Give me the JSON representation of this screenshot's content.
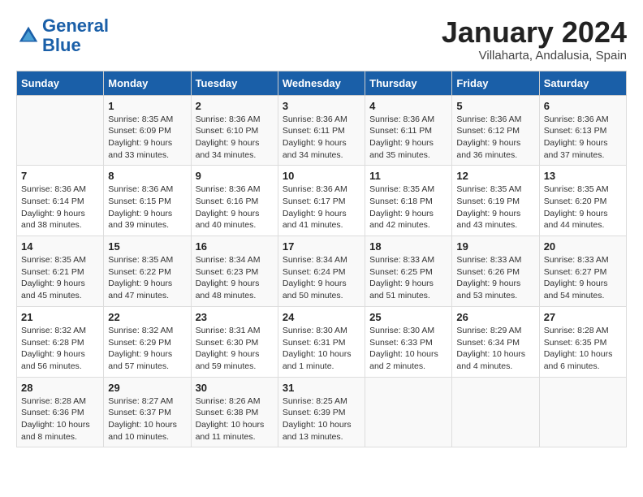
{
  "header": {
    "logo_line1": "General",
    "logo_line2": "Blue",
    "main_title": "January 2024",
    "subtitle": "Villaharta, Andalusia, Spain"
  },
  "calendar": {
    "weekdays": [
      "Sunday",
      "Monday",
      "Tuesday",
      "Wednesday",
      "Thursday",
      "Friday",
      "Saturday"
    ],
    "weeks": [
      [
        {
          "day": "",
          "sunrise": "",
          "sunset": "",
          "daylight": ""
        },
        {
          "day": "1",
          "sunrise": "Sunrise: 8:35 AM",
          "sunset": "Sunset: 6:09 PM",
          "daylight": "Daylight: 9 hours and 33 minutes."
        },
        {
          "day": "2",
          "sunrise": "Sunrise: 8:36 AM",
          "sunset": "Sunset: 6:10 PM",
          "daylight": "Daylight: 9 hours and 34 minutes."
        },
        {
          "day": "3",
          "sunrise": "Sunrise: 8:36 AM",
          "sunset": "Sunset: 6:11 PM",
          "daylight": "Daylight: 9 hours and 34 minutes."
        },
        {
          "day": "4",
          "sunrise": "Sunrise: 8:36 AM",
          "sunset": "Sunset: 6:11 PM",
          "daylight": "Daylight: 9 hours and 35 minutes."
        },
        {
          "day": "5",
          "sunrise": "Sunrise: 8:36 AM",
          "sunset": "Sunset: 6:12 PM",
          "daylight": "Daylight: 9 hours and 36 minutes."
        },
        {
          "day": "6",
          "sunrise": "Sunrise: 8:36 AM",
          "sunset": "Sunset: 6:13 PM",
          "daylight": "Daylight: 9 hours and 37 minutes."
        }
      ],
      [
        {
          "day": "7",
          "sunrise": "Sunrise: 8:36 AM",
          "sunset": "Sunset: 6:14 PM",
          "daylight": "Daylight: 9 hours and 38 minutes."
        },
        {
          "day": "8",
          "sunrise": "Sunrise: 8:36 AM",
          "sunset": "Sunset: 6:15 PM",
          "daylight": "Daylight: 9 hours and 39 minutes."
        },
        {
          "day": "9",
          "sunrise": "Sunrise: 8:36 AM",
          "sunset": "Sunset: 6:16 PM",
          "daylight": "Daylight: 9 hours and 40 minutes."
        },
        {
          "day": "10",
          "sunrise": "Sunrise: 8:36 AM",
          "sunset": "Sunset: 6:17 PM",
          "daylight": "Daylight: 9 hours and 41 minutes."
        },
        {
          "day": "11",
          "sunrise": "Sunrise: 8:35 AM",
          "sunset": "Sunset: 6:18 PM",
          "daylight": "Daylight: 9 hours and 42 minutes."
        },
        {
          "day": "12",
          "sunrise": "Sunrise: 8:35 AM",
          "sunset": "Sunset: 6:19 PM",
          "daylight": "Daylight: 9 hours and 43 minutes."
        },
        {
          "day": "13",
          "sunrise": "Sunrise: 8:35 AM",
          "sunset": "Sunset: 6:20 PM",
          "daylight": "Daylight: 9 hours and 44 minutes."
        }
      ],
      [
        {
          "day": "14",
          "sunrise": "Sunrise: 8:35 AM",
          "sunset": "Sunset: 6:21 PM",
          "daylight": "Daylight: 9 hours and 45 minutes."
        },
        {
          "day": "15",
          "sunrise": "Sunrise: 8:35 AM",
          "sunset": "Sunset: 6:22 PM",
          "daylight": "Daylight: 9 hours and 47 minutes."
        },
        {
          "day": "16",
          "sunrise": "Sunrise: 8:34 AM",
          "sunset": "Sunset: 6:23 PM",
          "daylight": "Daylight: 9 hours and 48 minutes."
        },
        {
          "day": "17",
          "sunrise": "Sunrise: 8:34 AM",
          "sunset": "Sunset: 6:24 PM",
          "daylight": "Daylight: 9 hours and 50 minutes."
        },
        {
          "day": "18",
          "sunrise": "Sunrise: 8:33 AM",
          "sunset": "Sunset: 6:25 PM",
          "daylight": "Daylight: 9 hours and 51 minutes."
        },
        {
          "day": "19",
          "sunrise": "Sunrise: 8:33 AM",
          "sunset": "Sunset: 6:26 PM",
          "daylight": "Daylight: 9 hours and 53 minutes."
        },
        {
          "day": "20",
          "sunrise": "Sunrise: 8:33 AM",
          "sunset": "Sunset: 6:27 PM",
          "daylight": "Daylight: 9 hours and 54 minutes."
        }
      ],
      [
        {
          "day": "21",
          "sunrise": "Sunrise: 8:32 AM",
          "sunset": "Sunset: 6:28 PM",
          "daylight": "Daylight: 9 hours and 56 minutes."
        },
        {
          "day": "22",
          "sunrise": "Sunrise: 8:32 AM",
          "sunset": "Sunset: 6:29 PM",
          "daylight": "Daylight: 9 hours and 57 minutes."
        },
        {
          "day": "23",
          "sunrise": "Sunrise: 8:31 AM",
          "sunset": "Sunset: 6:30 PM",
          "daylight": "Daylight: 9 hours and 59 minutes."
        },
        {
          "day": "24",
          "sunrise": "Sunrise: 8:30 AM",
          "sunset": "Sunset: 6:31 PM",
          "daylight": "Daylight: 10 hours and 1 minute."
        },
        {
          "day": "25",
          "sunrise": "Sunrise: 8:30 AM",
          "sunset": "Sunset: 6:33 PM",
          "daylight": "Daylight: 10 hours and 2 minutes."
        },
        {
          "day": "26",
          "sunrise": "Sunrise: 8:29 AM",
          "sunset": "Sunset: 6:34 PM",
          "daylight": "Daylight: 10 hours and 4 minutes."
        },
        {
          "day": "27",
          "sunrise": "Sunrise: 8:28 AM",
          "sunset": "Sunset: 6:35 PM",
          "daylight": "Daylight: 10 hours and 6 minutes."
        }
      ],
      [
        {
          "day": "28",
          "sunrise": "Sunrise: 8:28 AM",
          "sunset": "Sunset: 6:36 PM",
          "daylight": "Daylight: 10 hours and 8 minutes."
        },
        {
          "day": "29",
          "sunrise": "Sunrise: 8:27 AM",
          "sunset": "Sunset: 6:37 PM",
          "daylight": "Daylight: 10 hours and 10 minutes."
        },
        {
          "day": "30",
          "sunrise": "Sunrise: 8:26 AM",
          "sunset": "Sunset: 6:38 PM",
          "daylight": "Daylight: 10 hours and 11 minutes."
        },
        {
          "day": "31",
          "sunrise": "Sunrise: 8:25 AM",
          "sunset": "Sunset: 6:39 PM",
          "daylight": "Daylight: 10 hours and 13 minutes."
        },
        {
          "day": "",
          "sunrise": "",
          "sunset": "",
          "daylight": ""
        },
        {
          "day": "",
          "sunrise": "",
          "sunset": "",
          "daylight": ""
        },
        {
          "day": "",
          "sunrise": "",
          "sunset": "",
          "daylight": ""
        }
      ]
    ]
  }
}
